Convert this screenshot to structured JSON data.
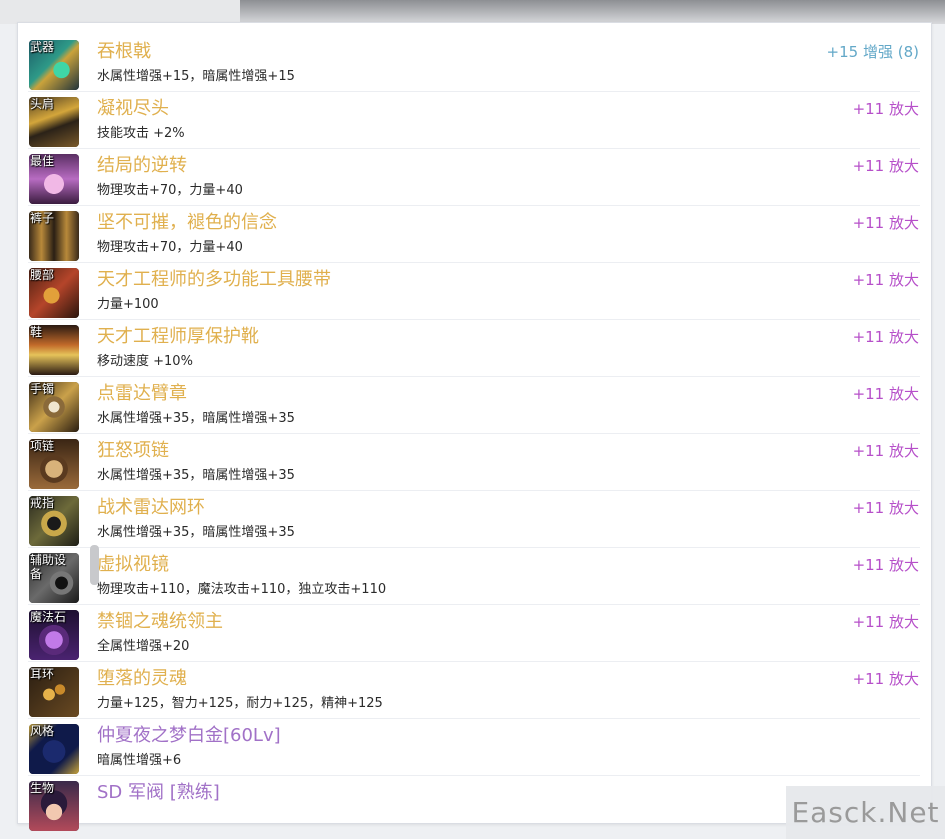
{
  "colors": {
    "title_gold": "#e0b04e",
    "title_purple": "#a171c7",
    "level_magenta": "#b64fc9",
    "level_teal": "#63a8c8"
  },
  "equipment": [
    {
      "slot": "武器",
      "icon": "weapon-icon",
      "name": "吞根戟",
      "stats": "水属性增强+15，暗属性增强+15",
      "level": "+15 增强 (8)"
    },
    {
      "slot": "头肩",
      "icon": "shoulder-icon",
      "name": "凝视尽头",
      "stats": "技能攻击 +2%",
      "level": "+11 放大"
    },
    {
      "slot": "最佳",
      "icon": "top-armor-icon",
      "name": "结局的逆转",
      "stats": "物理攻击+70，力量+40",
      "level": "+11 放大"
    },
    {
      "slot": "裤子",
      "icon": "pants-icon",
      "name": "坚不可摧，褪色的信念",
      "stats": "物理攻击+70，力量+40",
      "level": "+11 放大"
    },
    {
      "slot": "腰部",
      "icon": "belt-icon",
      "name": "天才工程师的多功能工具腰带",
      "stats": "力量+100",
      "level": "+11 放大"
    },
    {
      "slot": "鞋",
      "icon": "boots-icon",
      "name": "天才工程师厚保护靴",
      "stats": "移动速度 +10%",
      "level": "+11 放大"
    },
    {
      "slot": "手镯",
      "icon": "bracelet-icon",
      "name": "点雷达臂章",
      "stats": "水属性增强+35，暗属性增强+35",
      "level": "+11 放大"
    },
    {
      "slot": "项链",
      "icon": "necklace-icon",
      "name": "狂怒项链",
      "stats": "水属性增强+35，暗属性增强+35",
      "level": "+11 放大"
    },
    {
      "slot": "戒指",
      "icon": "ring-icon",
      "name": "战术雷达网环",
      "stats": "水属性增强+35，暗属性增强+35",
      "level": "+11 放大"
    },
    {
      "slot": "辅助设\n备",
      "icon": "support-device-icon",
      "name": "虚拟视镜",
      "stats": "物理攻击+110，魔法攻击+110，独立攻击+110",
      "level": "+11 放大"
    },
    {
      "slot": "魔法石",
      "icon": "magic-stone-icon",
      "name": "禁锢之魂统领主",
      "stats": "全属性增强+20",
      "level": "+11 放大"
    },
    {
      "slot": "耳环",
      "icon": "earring-icon",
      "name": "堕落的灵魂",
      "stats": "力量+125，智力+125，耐力+125，精神+125",
      "level": "+11 放大"
    },
    {
      "slot": "风格",
      "icon": "style-icon",
      "name": "仲夏夜之梦白金[60Lv]",
      "stats": "暗属性增强+6",
      "level": ""
    },
    {
      "slot": "生物",
      "icon": "creature-icon",
      "name": "SD 军阀 [熟练]",
      "stats": "",
      "level": ""
    }
  ],
  "watermark": "Easck.Net"
}
